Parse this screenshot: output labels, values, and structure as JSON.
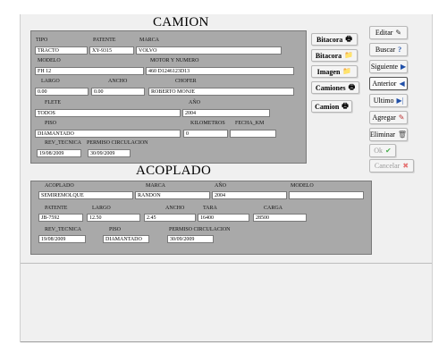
{
  "camion": {
    "title": "CAMION",
    "labels": {
      "tipo": "TIPO",
      "patente": "PATENTE",
      "marca": "MARCA",
      "modelo": "MODELO",
      "motor": "MOTOR Y NUMERO",
      "largo": "LARGO",
      "ancho": "ANCHO",
      "chofer": "CHOFER",
      "flete": "FLETE",
      "anio": "AÑO",
      "piso": "PISO",
      "kilometros": "KILOMETROS",
      "fecha_km": "FECHA_KM",
      "rev_tecnica": "REV_TECNICA",
      "permiso": "PERMISO CIRCULACION"
    },
    "values": {
      "tipo": "TRACTO",
      "patente": "XY-9315",
      "marca": "VOLVO",
      "modelo": "FH 12",
      "motor": "460  D1246123D13",
      "largo": "0.00",
      "ancho": "0.00",
      "chofer": "ROBERTO MONJE",
      "flete": "TODOS",
      "anio": "2004",
      "piso": "DIAMANTADO",
      "kilometros": "0",
      "fecha_km": "",
      "rev_tecnica": "19/08/2009",
      "permiso": "30/09/2009"
    }
  },
  "acoplado": {
    "title": "ACOPLADO",
    "labels": {
      "acoplado": "ACOPLADO",
      "marca": "MARCA",
      "anio": "AÑO",
      "modelo": "MODELO",
      "patente": "PATENTE",
      "largo": "LARGO",
      "ancho": "ANCHO",
      "tara": "TARA",
      "carga": "CARGA",
      "rev_tecnica": "REV_TECNICA",
      "piso": "PISO",
      "permiso": "PERMISO CIRCULACION"
    },
    "values": {
      "acoplado": "SEMIREMOLQUE",
      "marca": "RANDON",
      "anio": "2004",
      "modelo": "",
      "patente": "JB-7592",
      "largo": "12.50",
      "ancho": "2.45",
      "tara": "16400",
      "carga": "28500",
      "rev_tecnica": "19/08/2009",
      "piso": "DIAMANTADO",
      "permiso": "30/09/2009"
    }
  },
  "side_buttons": {
    "bitacora1": "Bitacora",
    "bitacora2": "Bitacora",
    "imagen": "Imagen",
    "camiones": "Camiones",
    "camion": "Camion"
  },
  "nav_buttons": {
    "editar": "Editar",
    "buscar": "Buscar",
    "siguiente": "Siguiente",
    "anterior": "Anterior",
    "ultimo": "Ultimo",
    "agregar": "Agregar",
    "eliminar": "Eliminar",
    "ok": "Ok",
    "cancelar": "Cancelar"
  },
  "icons": {
    "print": "printer-icon",
    "folder": "folder-icon",
    "edit": "edit-icon",
    "search": "help-icon",
    "next": "next-icon",
    "prev": "prev-icon",
    "last": "last-icon",
    "add": "add-icon",
    "delete": "trash-icon",
    "ok": "check-icon",
    "cancel": "x-icon"
  }
}
